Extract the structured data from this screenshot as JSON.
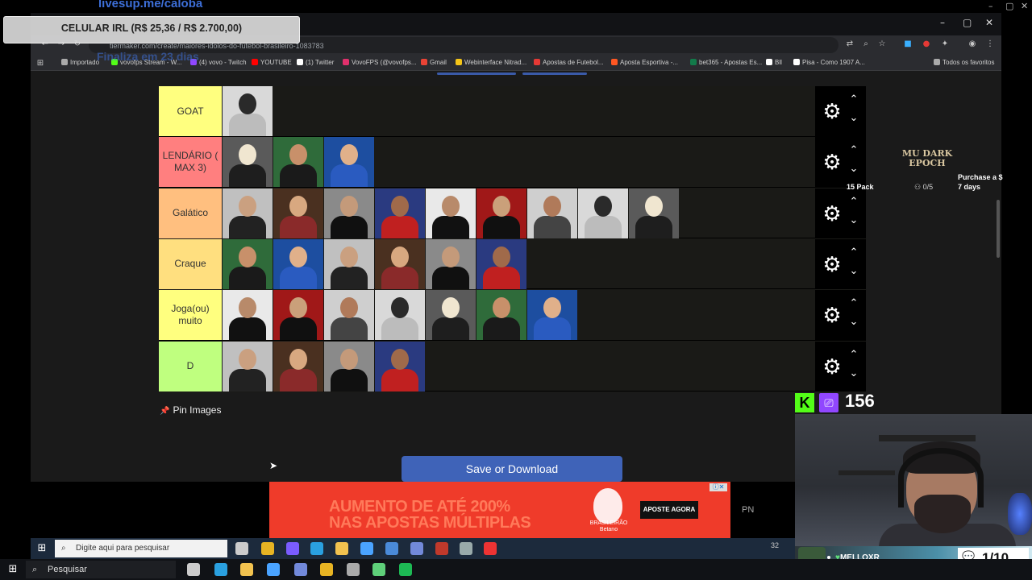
{
  "overlay": {
    "stream_url": "livesup.me/caloba",
    "donation_goal": "CELULAR IRL (R$ 25,36 / R$ 2.700,00)",
    "faded_text": "Finaliza em 23 dias"
  },
  "browser": {
    "url": "tiermaker.com/create/maiores-idolos-do-futebol-brasileiro-1083783",
    "window_controls": [
      "–",
      "▢",
      "✕"
    ],
    "outer_controls": [
      "–",
      "▢",
      "✕"
    ],
    "bookmarks": [
      {
        "label": "Importado",
        "color": "#aaaaaa"
      },
      {
        "label": "vovofps Stream - W...",
        "color": "#53fc18"
      },
      {
        "label": "(4) vovo - Twitch",
        "color": "#9147ff"
      },
      {
        "label": "YOUTUBE",
        "color": "#ff0000"
      },
      {
        "label": "(1) Twitter",
        "color": "#ffffff"
      },
      {
        "label": "VovoFPS (@vovofps...",
        "color": "#e1306c"
      },
      {
        "label": "Gmail",
        "color": "#ea4335"
      },
      {
        "label": "Webinterface Nitrad...",
        "color": "#f5c518"
      },
      {
        "label": "Apostas de Futebol...",
        "color": "#e53935"
      },
      {
        "label": "Aposta Esportiva -...",
        "color": "#ff5722"
      },
      {
        "label": "bet365 - Apostas Es...",
        "color": "#127a4a"
      },
      {
        "label": "Bll",
        "color": "#ffffff"
      },
      {
        "label": "Pisa - Como 1907 A...",
        "color": "#ffffff"
      },
      {
        "label": "Todos os favoritos",
        "color": "#aaaaaa"
      }
    ]
  },
  "tierlist": {
    "tiers": [
      {
        "label": "GOAT",
        "color": "#ffff7f",
        "count": 1
      },
      {
        "label": "LENDÁRIO ( MAX 3)",
        "color": "#ff7f7f",
        "count": 3
      },
      {
        "label": "Galático",
        "color": "#ffbf7f",
        "count": 9
      },
      {
        "label": "Craque",
        "color": "#ffdf7f",
        "count": 6
      },
      {
        "label": "Joga(ou) muito",
        "color": "#ffff7f",
        "count": 7
      },
      {
        "label": "D",
        "color": "#bfff7f",
        "count": 4
      }
    ],
    "pin_images_label": "Pin Images",
    "save_button_label": "Save or Download",
    "settings_icon": "gear-icon",
    "move_up_icon": "chevron-up-icon",
    "move_down_icon": "chevron-down-icon"
  },
  "ad": {
    "line1": "AUMENTO DE ATÉ 200%",
    "line2": "NAS APOSTAS MÚLTIPLAS",
    "brand": "BRASILEIRÃO Betano",
    "cta": "APOSTE AGORA",
    "side_text": "PN"
  },
  "widget": {
    "game_logo": "MU DARK EPOCH",
    "pack_label": "15 Pack",
    "pack_count": "0/5",
    "purchase_label": "Purchase a $ 7 days"
  },
  "stream": {
    "viewer_count": "156",
    "chat_user": "MELLOXR_",
    "chat_counter": "1/10"
  },
  "taskbar": {
    "inner_search_placeholder": "Digite aqui para pesquisar",
    "inner_tray_text": "32",
    "outer_search_placeholder": "Pesquisar"
  }
}
